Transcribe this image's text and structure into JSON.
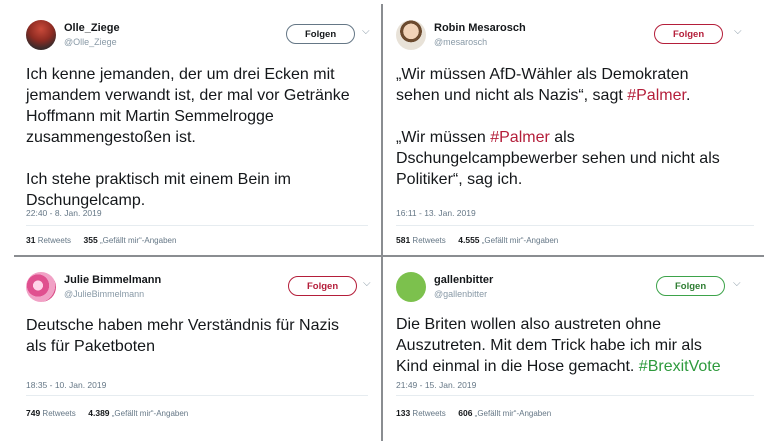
{
  "tweets": [
    {
      "name": "Olle_Ziege",
      "handle": "@Olle_Ziege",
      "follow_label": "Folgen",
      "text_lines": [
        "Ich kenne jemanden, der um drei Ecken mit",
        "jemandem verwandt ist, der mal vor Getränke",
        "Hoffmann mit Martin Semmelrogge",
        "zusammengestoßen ist.",
        "",
        "Ich stehe praktisch mit einem Bein im",
        "Dschungelcamp."
      ],
      "timestamp": "22:40 - 8. Jan. 2019",
      "retweets": "31",
      "retweets_label": "Retweets",
      "likes": "355",
      "likes_label": "„Gefällt mir“-Angaben"
    },
    {
      "name": "Robin Mesarosch",
      "handle": "@mesarosch",
      "follow_label": "Folgen",
      "para1_line1": "„Wir müssen AfD-Wähler als Demokraten",
      "para1_line2_pre": "sehen und nicht als Nazis“, sagt ",
      "para1_hashtag": "#Palmer",
      "para1_line2_post": ".",
      "para2_line1_pre": "„Wir müssen ",
      "para2_hashtag": "#Palmer",
      "para2_line1_post": " als",
      "para2_line2": "Dschungelcampbewerber sehen und nicht als",
      "para2_line3": "Politiker“, sag ich.",
      "timestamp": "16:11 - 13. Jan. 2019",
      "retweets": "581",
      "retweets_label": "Retweets",
      "likes": "4.555",
      "likes_label": "„Gefällt mir“-Angaben"
    },
    {
      "name": "Julie Bimmelmann",
      "handle": "@JulieBimmelmann",
      "follow_label": "Folgen",
      "text_lines": [
        "Deutsche haben mehr Verständnis für Nazis",
        "als für Paketboten"
      ],
      "timestamp": "18:35 - 10. Jan. 2019",
      "retweets": "749",
      "retweets_label": "Retweets",
      "likes": "4.389",
      "likes_label": "„Gefällt mir“-Angaben"
    },
    {
      "name": "gallenbitter",
      "handle": "@gallenbitter",
      "follow_label": "Folgen",
      "line1": "Die Briten wollen also austreten ohne",
      "line2": "Auszutreten. Mit dem Trick habe ich mir als",
      "line3_pre": "Kind einmal in die Hose gemacht. ",
      "hashtag": "#BrexitVote",
      "timestamp": "21:49 - 15. Jan. 2019",
      "retweets": "133",
      "retweets_label": "Retweets",
      "likes": "606",
      "likes_label": "„Gefällt mir“-Angaben"
    }
  ],
  "icons": {
    "menu": "chevron-down-icon"
  },
  "colors": {
    "follow_red": "#b41e3a",
    "hashtag_red": "#b41e3a",
    "hashtag_green": "#2e9a3d",
    "follow_green": "#3da34a"
  }
}
